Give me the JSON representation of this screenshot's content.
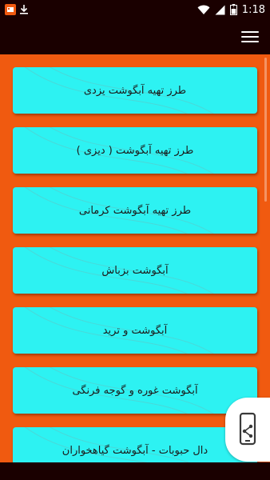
{
  "status_bar": {
    "time": "1:18",
    "icons": [
      "app-badge-icon",
      "download-icon",
      "wifi-icon",
      "signal-icon",
      "battery-icon"
    ]
  },
  "app_bar": {
    "menu_icon": "hamburger-menu-icon"
  },
  "colors": {
    "background": "#f05a10",
    "bars": "#1a0000",
    "card": "#2df2f2",
    "text": "#1a1a1a"
  },
  "recipes": [
    {
      "label": "طرز تهیه آبگوشت یزدی"
    },
    {
      "label": "طرز تهیه آبگوشت ( دیزی )"
    },
    {
      "label": "طرز تهیه آبگوشت کرمانی"
    },
    {
      "label": "آبگوشت بزباش"
    },
    {
      "label": "آبگوشت و ترید"
    },
    {
      "label": "آبگوشت غوره و گوجه فرنگی"
    },
    {
      "label": "دال حبوبات - آبگوشت گیاهخواران"
    }
  ],
  "share_button": {
    "icon": "share-phone-icon"
  }
}
